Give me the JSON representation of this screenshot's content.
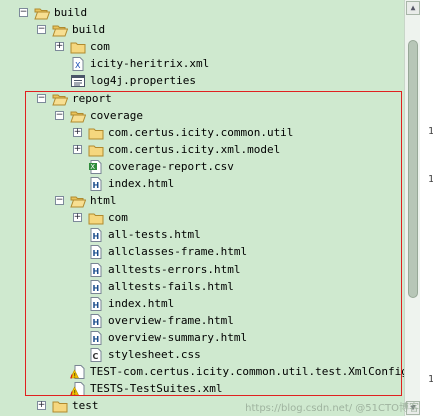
{
  "tree": {
    "rows": [
      {
        "label": "build",
        "expander": "minus",
        "icon": "folder-open-icon"
      },
      {
        "label": "build",
        "expander": "minus",
        "icon": "folder-open-icon"
      },
      {
        "label": "com",
        "expander": "plus",
        "icon": "folder-icon"
      },
      {
        "label": "icity-heritrix.xml",
        "expander": "none",
        "icon": "xml-file-icon"
      },
      {
        "label": "log4j.properties",
        "expander": "none",
        "icon": "properties-file-icon"
      },
      {
        "label": "report",
        "expander": "minus",
        "icon": "folder-open-icon"
      },
      {
        "label": "coverage",
        "expander": "minus",
        "icon": "folder-open-icon"
      },
      {
        "label": "com.certus.icity.common.util",
        "expander": "plus",
        "icon": "folder-icon"
      },
      {
        "label": "com.certus.icity.xml.model",
        "expander": "plus",
        "icon": "folder-icon"
      },
      {
        "label": "coverage-report.csv",
        "expander": "none",
        "icon": "csv-file-icon"
      },
      {
        "label": "index.html",
        "expander": "none",
        "icon": "html-file-icon"
      },
      {
        "label": "html",
        "expander": "minus",
        "icon": "folder-open-icon"
      },
      {
        "label": "com",
        "expander": "plus",
        "icon": "folder-icon"
      },
      {
        "label": "all-tests.html",
        "expander": "none",
        "icon": "html-file-icon"
      },
      {
        "label": "allclasses-frame.html",
        "expander": "none",
        "icon": "html-file-icon"
      },
      {
        "label": "alltests-errors.html",
        "expander": "none",
        "icon": "html-file-icon"
      },
      {
        "label": "alltests-fails.html",
        "expander": "none",
        "icon": "html-file-icon"
      },
      {
        "label": "index.html",
        "expander": "none",
        "icon": "html-file-icon"
      },
      {
        "label": "overview-frame.html",
        "expander": "none",
        "icon": "html-file-icon"
      },
      {
        "label": "overview-summary.html",
        "expander": "none",
        "icon": "html-file-icon"
      },
      {
        "label": "stylesheet.css",
        "expander": "none",
        "icon": "css-file-icon"
      },
      {
        "label": "TEST-com.certus.icity.common.util.test.XmlConfigPars",
        "expander": "none",
        "icon": "xml-warning-file-icon"
      },
      {
        "label": "TESTS-TestSuites.xml",
        "expander": "none",
        "icon": "xml-warning-file-icon"
      },
      {
        "label": "test",
        "expander": "plus",
        "icon": "folder-icon"
      }
    ]
  },
  "gutter": {
    "mark1": "1",
    "mark2": "1",
    "mark3": "1"
  },
  "watermark": "https://blog.csdn.net/ @51CTO博客",
  "colors": {
    "tree_background": "#cfe9cf",
    "highlight_border": "#e02020",
    "folder_fill": "#f5d77e",
    "folder_stroke": "#b08a2e"
  }
}
